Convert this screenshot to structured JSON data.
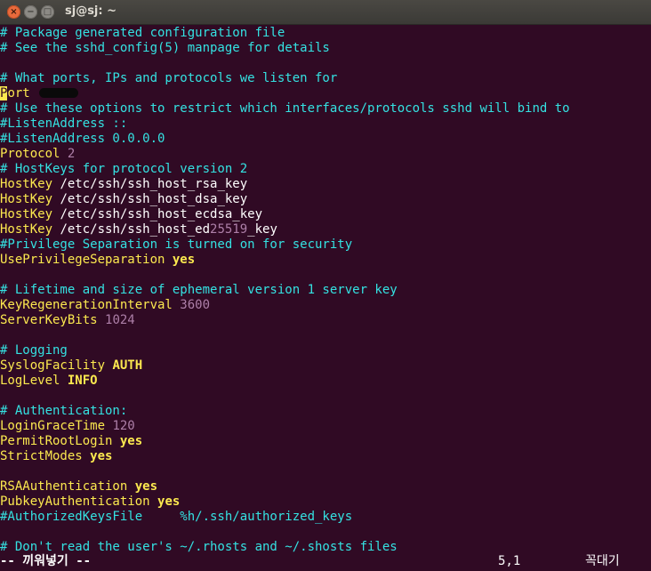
{
  "window": {
    "title": "sj@sj: ~",
    "buttons": {
      "close": "×",
      "minimize": "−",
      "maximize": "□"
    }
  },
  "editor": {
    "lines": [
      [
        [
          "c",
          "# Package generated configuration file"
        ]
      ],
      [
        [
          "c",
          "# See the sshd_config(5) manpage for details"
        ]
      ],
      [],
      [
        [
          "c",
          "# What ports, IPs and protocols we listen for"
        ]
      ],
      [
        [
          "cursor",
          "P"
        ],
        [
          "k",
          "ort "
        ],
        [
          "redact",
          ""
        ]
      ],
      [
        [
          "c",
          "# Use these options to restrict which interfaces/protocols sshd will bind to"
        ]
      ],
      [
        [
          "c",
          "#ListenAddress ::"
        ]
      ],
      [
        [
          "c",
          "#ListenAddress 0.0.0.0"
        ]
      ],
      [
        [
          "k",
          "Protocol "
        ],
        [
          "n",
          "2"
        ]
      ],
      [
        [
          "c",
          "# HostKeys for protocol version 2"
        ]
      ],
      [
        [
          "k",
          "HostKey "
        ],
        [
          "t",
          "/etc/ssh/ssh_host_rsa_key"
        ]
      ],
      [
        [
          "k",
          "HostKey "
        ],
        [
          "t",
          "/etc/ssh/ssh_host_dsa_key"
        ]
      ],
      [
        [
          "k",
          "HostKey "
        ],
        [
          "t",
          "/etc/ssh/ssh_host_ecdsa_key"
        ]
      ],
      [
        [
          "k",
          "HostKey "
        ],
        [
          "t",
          "/etc/ssh/ssh_host_ed"
        ],
        [
          "n",
          "25519"
        ],
        [
          "t",
          "_key"
        ]
      ],
      [
        [
          "c",
          "#Privilege Separation is turned on for security"
        ]
      ],
      [
        [
          "k",
          "UsePrivilegeSeparation "
        ],
        [
          "b",
          "yes"
        ]
      ],
      [],
      [
        [
          "c",
          "# Lifetime and size of ephemeral version 1 server key"
        ]
      ],
      [
        [
          "k",
          "KeyRegenerationInterval "
        ],
        [
          "n",
          "3600"
        ]
      ],
      [
        [
          "k",
          "ServerKeyBits "
        ],
        [
          "n",
          "1024"
        ]
      ],
      [],
      [
        [
          "c",
          "# Logging"
        ]
      ],
      [
        [
          "k",
          "SyslogFacility "
        ],
        [
          "b",
          "AUTH"
        ]
      ],
      [
        [
          "k",
          "LogLevel "
        ],
        [
          "b",
          "INFO"
        ]
      ],
      [],
      [
        [
          "c",
          "# Authentication:"
        ]
      ],
      [
        [
          "k",
          "LoginGraceTime "
        ],
        [
          "n",
          "120"
        ]
      ],
      [
        [
          "k",
          "PermitRootLogin "
        ],
        [
          "b",
          "yes"
        ]
      ],
      [
        [
          "k",
          "StrictModes "
        ],
        [
          "b",
          "yes"
        ]
      ],
      [],
      [
        [
          "k",
          "RSAAuthentication "
        ],
        [
          "b",
          "yes"
        ]
      ],
      [
        [
          "k",
          "PubkeyAuthentication "
        ],
        [
          "b",
          "yes"
        ]
      ],
      [
        [
          "c",
          "#AuthorizedKeysFile     %h/.ssh/authorized_keys"
        ]
      ],
      [],
      [
        [
          "c",
          "# Don't read the user's ~/.rhosts and ~/.shosts files"
        ]
      ]
    ]
  },
  "status": {
    "mode": "-- 끼워넣기 --",
    "position": "5,1",
    "scroll": "꼭대기"
  }
}
